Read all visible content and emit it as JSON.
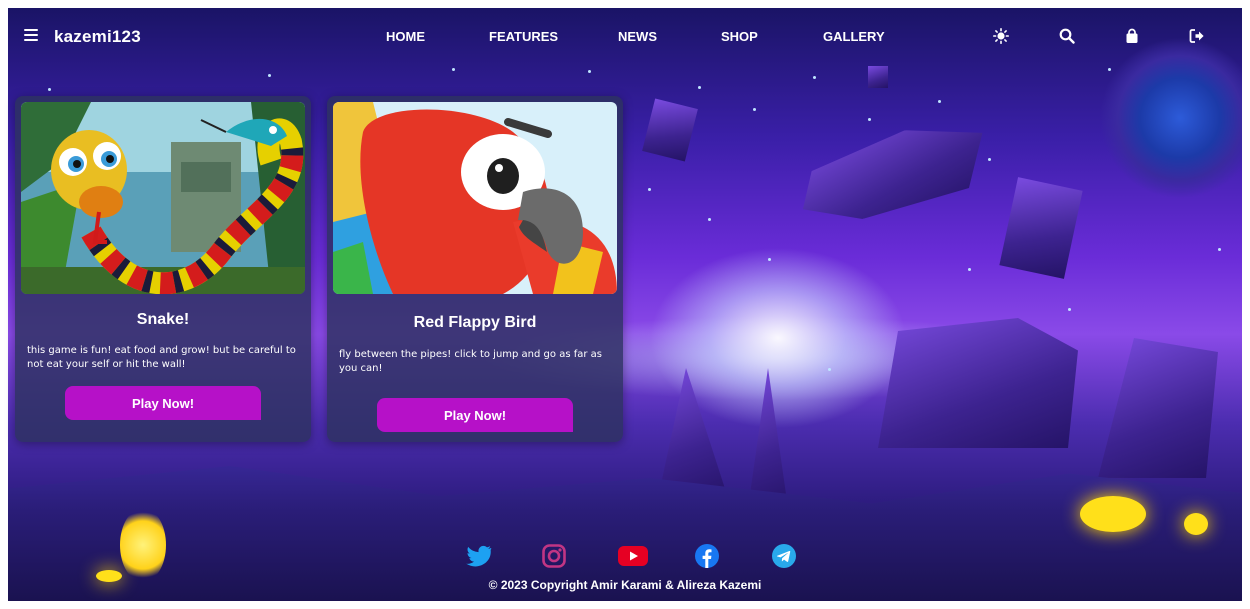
{
  "header": {
    "brand": "kazemi123",
    "nav": [
      "HOME",
      "FEATURES",
      "NEWS",
      "SHOP",
      "GALLERY"
    ],
    "icons": [
      "menu-icon",
      "sun-icon",
      "search-icon",
      "shopping-bag-icon",
      "logout-icon"
    ]
  },
  "games": [
    {
      "title": "Snake!",
      "description": "this game is fun! eat food and grow! but be careful to not eat your self or hit the wall!",
      "button": "Play Now!"
    },
    {
      "title": "Red Flappy Bird",
      "description": "fly between the pipes! click to jump and go as far as you can!",
      "button": "Play Now!"
    }
  ],
  "footer": {
    "social_icons": [
      "twitter-icon",
      "instagram-icon",
      "youtube-icon",
      "facebook-icon",
      "telegram-icon"
    ],
    "copyright": "© 2023 Copyright Amir Karami & Alireza Kazemi"
  },
  "colors": {
    "button": "#b611c8",
    "twitter": "#1da1f2",
    "instagram": "#c13584",
    "youtube": "#e60023",
    "facebook": "#1877f2",
    "telegram": "#29a9eb"
  }
}
